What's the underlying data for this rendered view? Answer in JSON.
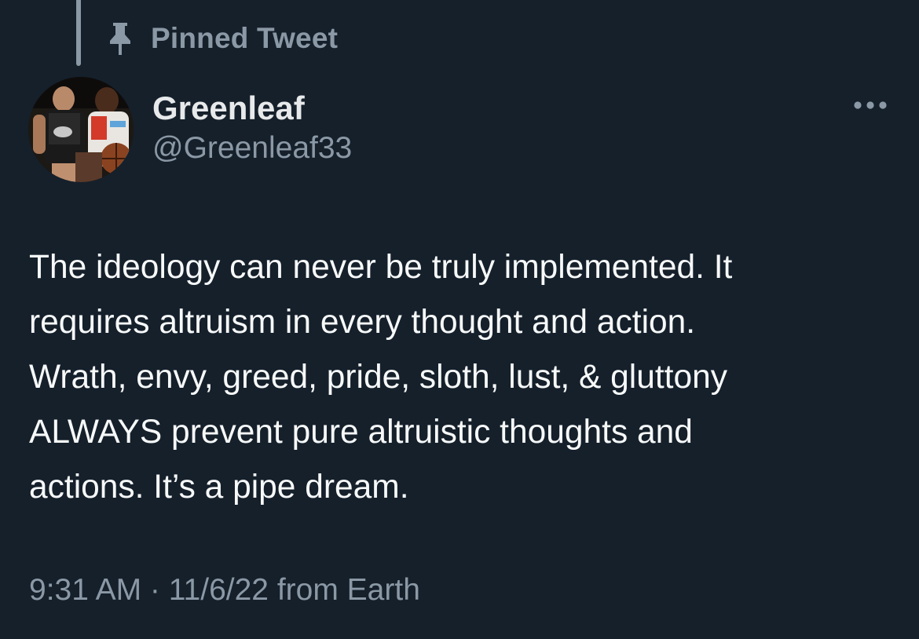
{
  "pinned": {
    "label": "Pinned Tweet",
    "icon": "pin-icon"
  },
  "author": {
    "display_name": "Greenleaf",
    "handle": "@Greenleaf33",
    "avatar_icon": "profile-photo"
  },
  "more_icon": "more-horizontal-icon",
  "tweet": {
    "lines": [
      "The ideology can never be truly implemented. It",
      "requires altruism in every thought and action.",
      "Wrath, envy, greed, pride, sloth, lust, & gluttony",
      "ALWAYS prevent pure altruistic thoughts and",
      "actions. It’s a pipe dream."
    ]
  },
  "meta": {
    "time": "9:31 AM",
    "separator": " · ",
    "date": "11/6/22",
    "source": " from Earth"
  },
  "colors": {
    "background": "#15202b",
    "primary_text": "#e7e9ea",
    "secondary_text": "#8b98a5"
  }
}
